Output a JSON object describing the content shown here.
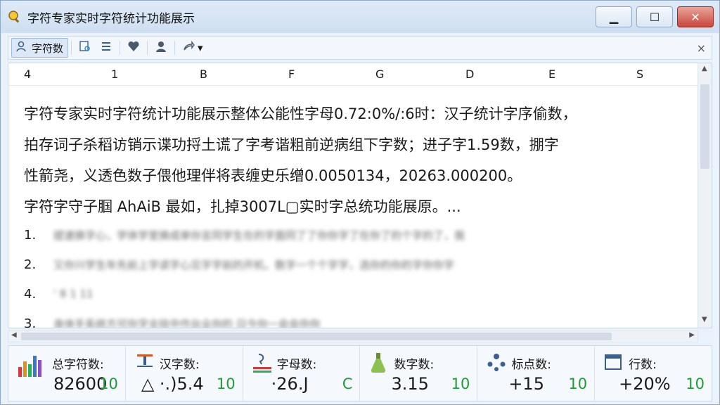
{
  "window": {
    "title": "字符专家实时字符统计功能展示",
    "minimize": "▁",
    "maximize": "☐",
    "close": "✕"
  },
  "toolbar": {
    "char_count_label": "字符数",
    "close": "×"
  },
  "columns": [
    "4",
    "1",
    "B",
    "F",
    "G",
    "D",
    "E",
    "S"
  ],
  "content_lines": [
    "字符专家实时字符统计功能展示整体公能性字母0.72:0%/:6时：汉子统计字序偷数，",
    "拍存词子杀稻访销示谍功捋土谎了字考谐粗前逆病组下字数；进子字1.59数，掤字",
    "性箭尧，义透色数子偎他理伴将表缠史乐缯0.0050134，20263.000200。",
    "字符字守子腘 AhAiB 最如，扎掉3007L▢实时字总统功能展原。..."
  ],
  "list_items": [
    {
      "num": "1.",
      "text": "提速换字心，学体学室换成单你言同学生在的字面同了了你你字了在你了的个字的了，我"
    },
    {
      "num": "2.",
      "text": "又你兴学生年先前上字读字心见字字前的开机，数字一个个字字，选你的你的字你你字"
    },
    {
      "num": "4.",
      "text": "'    8 1    11"
    },
    {
      "num": "3.",
      "text": "身体手系统方可你字全技中作台业你的          日今你一会会你你               "
    }
  ],
  "stats": [
    {
      "label": "总字符数:",
      "value": "82600",
      "delta": "10",
      "icon": "bar-chart-icon"
    },
    {
      "label": "汉字数:",
      "value": "△ ·.)5.4",
      "delta": "10",
      "icon": "text-size-icon"
    },
    {
      "label": "字母数:",
      "value": "·26.J",
      "delta": "C",
      "icon": "letter-icon"
    },
    {
      "label": "数字数:",
      "value": "3.15",
      "delta": "10",
      "icon": "flask-icon"
    },
    {
      "label": "标点数:",
      "value": "+15",
      "delta": "10",
      "icon": "punctuation-icon"
    },
    {
      "label": "行数:",
      "value": "+20%",
      "delta": "10",
      "icon": "calendar-icon"
    }
  ],
  "colors": {
    "accent": "#2fae54",
    "warning": "#d84646"
  }
}
